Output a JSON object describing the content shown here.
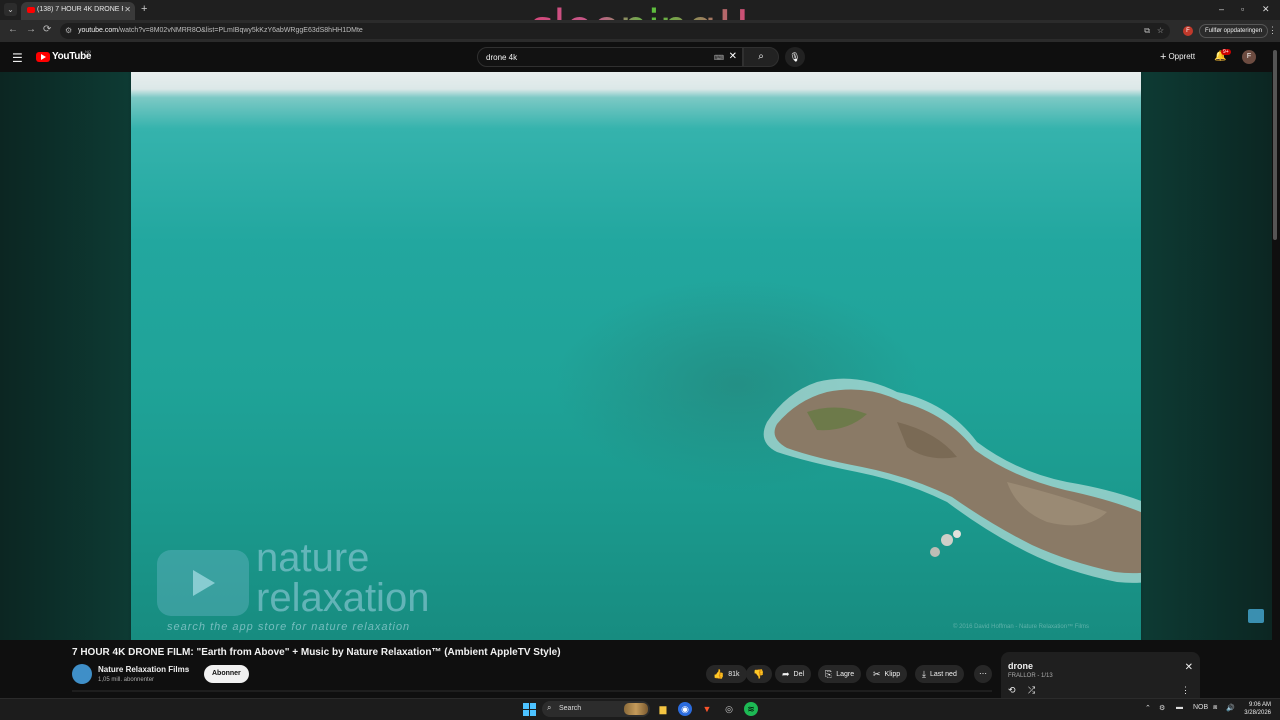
{
  "overlay": {
    "text": "sleeping!!"
  },
  "browser": {
    "tab_title": "(138) 7 HOUR 4K DRONE FILM: \"Ea",
    "url_host": "youtube.com",
    "url_path": "/watch?v=8M02vNMRR8O&list=PLmIBqwy5kKzY6abWRggE63dS8hHH1DMte",
    "update_label": "Fullfør oppdateringen",
    "profile_initial": "F"
  },
  "youtube": {
    "logo_text": "YouTube",
    "region": "NO",
    "search_value": "drone 4k",
    "create_label": "Opprett",
    "notif_count": "9+",
    "avatar_initial": "F"
  },
  "video": {
    "watermark_line1": "nature",
    "watermark_line2": "relaxation",
    "watermark_tagline": "search the app store for nature relaxation",
    "watermark_copyright": "© 2016 David Hoffman - Nature Relaxation™ Films",
    "title": "7 HOUR 4K DRONE FILM: \"Earth from Above\" + Music by Nature Relaxation™ (Ambient AppleTV Style)"
  },
  "channel": {
    "name": "Nature Relaxation Films",
    "subscribers": "1,05 mill. abonnenter",
    "subscribe_label": "Abonner"
  },
  "actions": {
    "likes": "81k",
    "share": "Del",
    "save": "Lagre",
    "clip": "Klipp",
    "download": "Last ned"
  },
  "playlist": {
    "title": "drone",
    "subtitle": "FRALLOR - 1/13"
  },
  "taskbar": {
    "search_label": "Search",
    "lang": "NOB",
    "time": "9:06 AM",
    "date": "3/28/2026"
  }
}
